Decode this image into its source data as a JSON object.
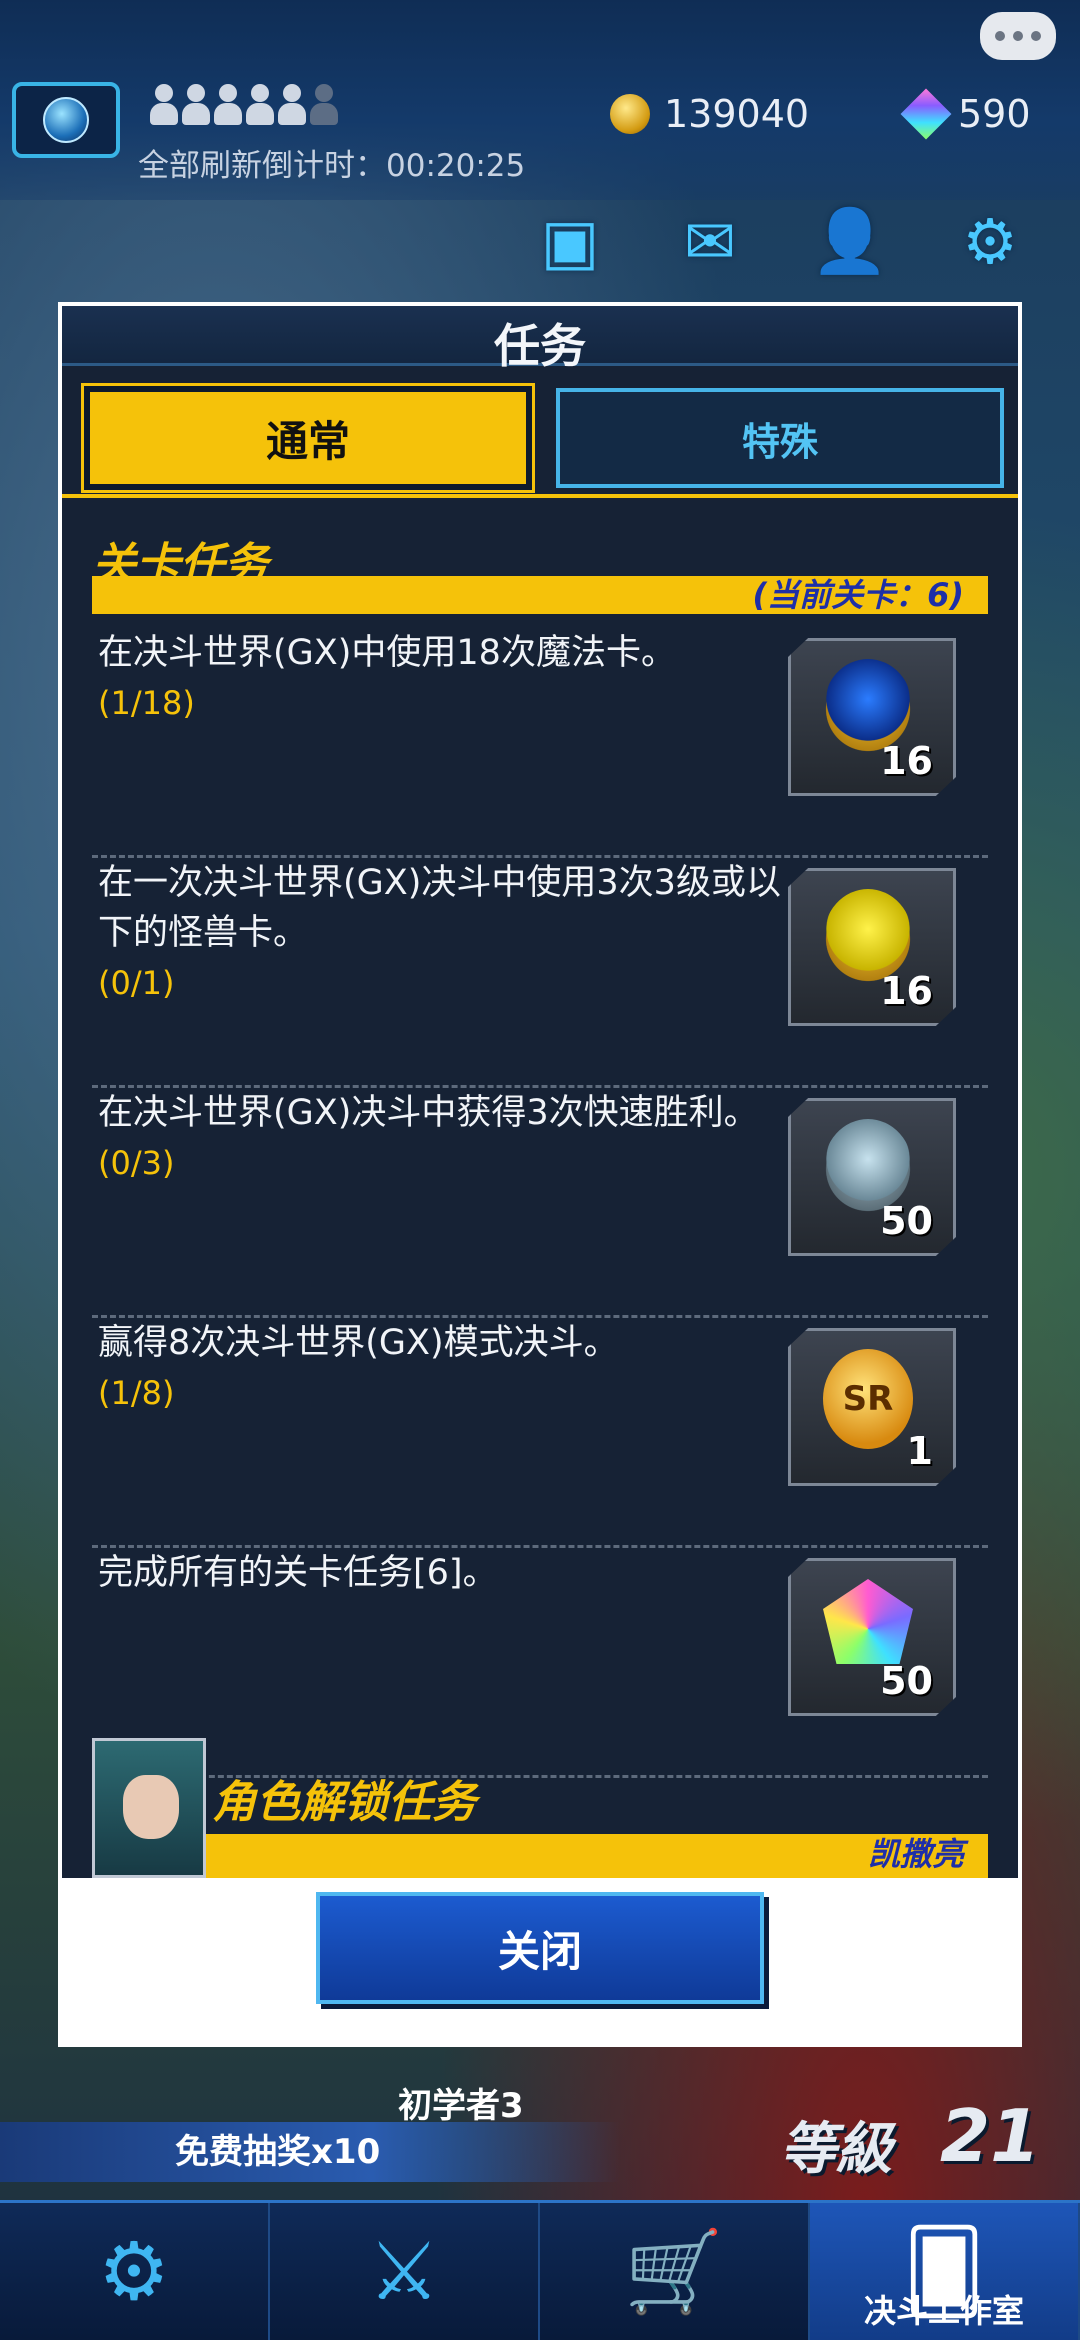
{
  "header": {
    "refresh_label": "全部刷新倒计时：00:20:25",
    "coins": "139040",
    "gems": "590"
  },
  "panel": {
    "title": "任务",
    "tabs": [
      {
        "label": "通常",
        "active": true
      },
      {
        "label": "特殊",
        "active": false
      }
    ],
    "section_title": "关卡任务",
    "section_subtitle": "(当前关卡：6)",
    "quests": [
      {
        "text": "在决斗世界(GX)中使用18次魔法卡。",
        "progress": "(1/18)",
        "reward_icon": "blue-key-icon",
        "reward_count": "16"
      },
      {
        "text": "在一次决斗世界(GX)决斗中使用3次3级或以下的怪兽卡。",
        "progress": "(0/1)",
        "reward_icon": "yellow-key-icon",
        "reward_count": "16"
      },
      {
        "text": "在决斗世界(GX)决斗中获得3次快速胜利。",
        "progress": "(0/3)",
        "reward_icon": "silver-key-icon",
        "reward_count": "50"
      },
      {
        "text": "赢得8次决斗世界(GX)模式决斗。",
        "progress": "(1/8)",
        "reward_icon": "sr-ticket-icon",
        "reward_count": "1"
      },
      {
        "text": "完成所有的关卡任务[6]。",
        "progress": "",
        "reward_icon": "rainbow-gem-icon",
        "reward_count": "50"
      }
    ],
    "sr_label": "SR",
    "char_section_title": "角色解锁任务",
    "char_section_subtitle": "凯撒亮",
    "close_label": "关闭"
  },
  "bottom": {
    "rank": "初学者3",
    "free_draw": "免费抽奖x10",
    "level_label": "等級",
    "level_value": "21",
    "nav_active_label": "决斗工作室"
  },
  "colors": {
    "accent_yellow": "#f5c20a",
    "accent_blue": "#46b4e8",
    "panel_bg": "#162235"
  }
}
